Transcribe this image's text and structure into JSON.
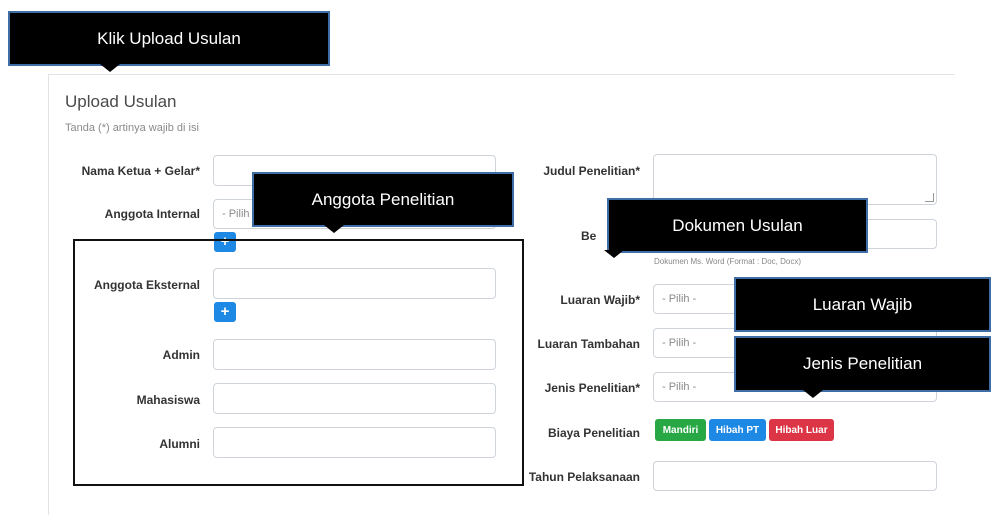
{
  "header": {
    "title": "Upload Usulan",
    "note": "Tanda (*) artinya wajib di isi"
  },
  "form": {
    "nama_ketua_label": "Nama Ketua + Gelar*",
    "anggota_internal_label": "Anggota Internal",
    "anggota_internal_placeholder": "- Pilih -",
    "anggota_eksternal_label": "Anggota Eksternal",
    "admin_label": "Admin",
    "mahasiswa_label": "Mahasiswa",
    "alumni_label": "Alumni",
    "judul_label": "Judul Penelitian*",
    "berkas_label": "Be",
    "berkas_hint": "Dokumen Ms. Word (Format : Doc, Docx)",
    "luaran_wajib_label": "Luaran Wajib*",
    "luaran_wajib_placeholder": "- Pilih -",
    "luaran_tambahan_label": "Luaran Tambahan",
    "luaran_tambahan_placeholder": "- Pilih -",
    "jenis_label": "Jenis Penelitian*",
    "jenis_placeholder": "- Pilih -",
    "biaya_label": "Biaya Penelitian",
    "biaya_options": [
      "Mandiri",
      "Hibah PT",
      "Hibah Luar"
    ],
    "tahun_label": "Tahun Pelaksanaan",
    "add_icon": "+"
  },
  "callouts": {
    "klik_upload": "Klik Upload Usulan",
    "anggota": "Anggota Penelitian",
    "dokumen": "Dokumen Usulan",
    "luaran_wajib": "Luaran Wajib",
    "jenis": "Jenis Penelitian"
  },
  "colors": {
    "callout_bg": "#000000",
    "callout_border": "#3f6ea6",
    "btn_mandiri": "#28a745",
    "btn_hibah_pt": "#1e88e5",
    "btn_hibah_luar": "#dc3545"
  }
}
